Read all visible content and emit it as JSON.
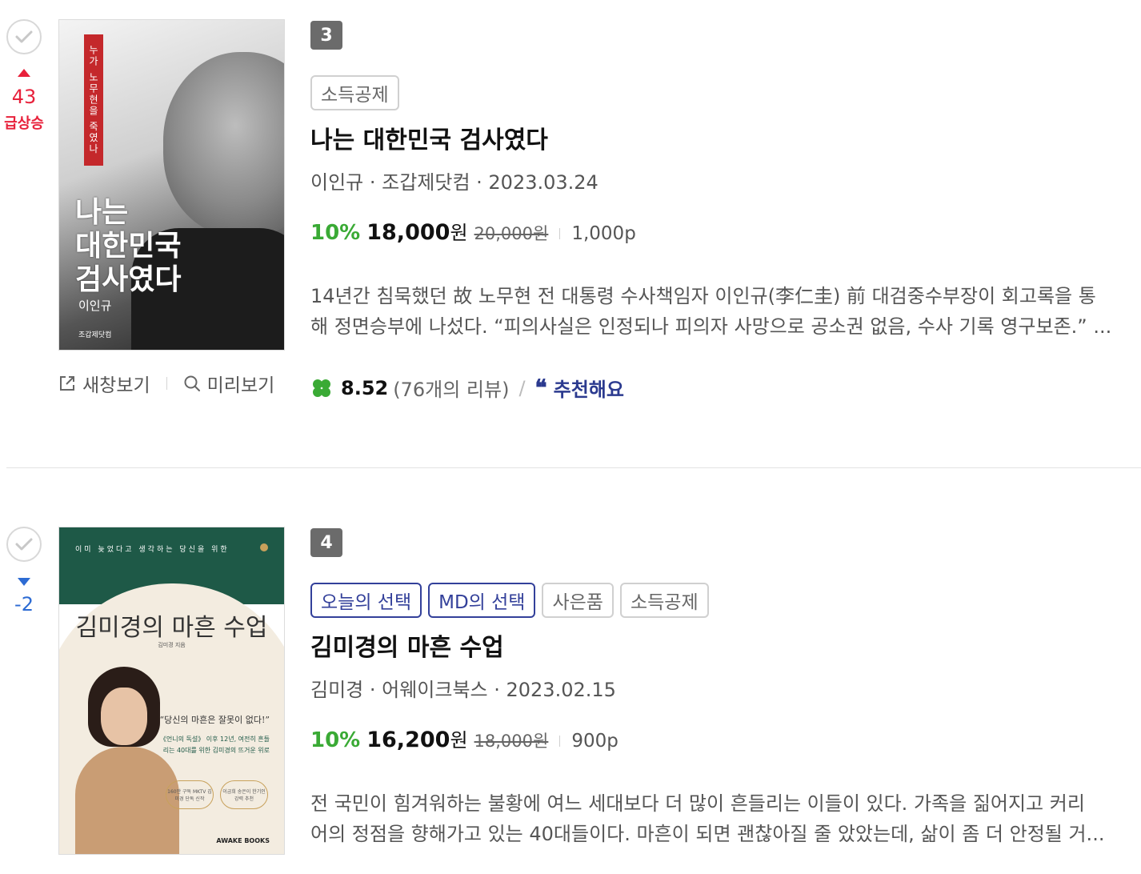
{
  "books": [
    {
      "rank": "3",
      "rank_change": "43",
      "rank_change_label": "급상승",
      "tags": [
        "소득공제"
      ],
      "title": "나는 대한민국 검사였다",
      "meta": "이인규 · 조갑제닷컴 · 2023.03.24",
      "discount": "10%",
      "price": "18,000",
      "won": "원",
      "original_price": "20,000원",
      "points": "1,000p",
      "description_line1": "14년간 침묵했던 故 노무현 전 대통령 수사책임자 이인규(李仁圭) 前 대검중수부장이 회고록을 통",
      "description_line2": "해 정면승부에 나섰다. “피의사실은 인정되나 피의자 사망으로 공소권 없음, 수사 기록 영구보존.” ...",
      "rating": "8.52",
      "review_count": "(76개의 리뷰)",
      "review_sep": "/",
      "recommend": "추천해요",
      "cover": {
        "red_bar": "누가 노무현을 죽였나",
        "title_lines": [
          "나는",
          "대한민국",
          "검사였다"
        ],
        "author": "이인규",
        "publisher": "조갑제닷컴"
      }
    },
    {
      "rank": "4",
      "rank_change": "-2",
      "tags": [
        "오늘의 선택",
        "MD의 선택",
        "사은품",
        "소득공제"
      ],
      "title": "김미경의 마흔 수업",
      "meta": "김미경 · 어웨이크북스 · 2023.02.15",
      "discount": "10%",
      "price": "16,200",
      "won": "원",
      "original_price": "18,000원",
      "points": "900p",
      "description_line1": "전 국민이 힘겨워하는 불황에 여느 세대보다 더 많이 흔들리는 이들이 있다. 가족을 짊어지고 커리",
      "description_line2": "어의 정점을 향해가고 있는 40대들이다. 마흔이 되면 괜찮아질 줄 았았는데, 삶이 좀 더 안정될 거...",
      "cover": {
        "top_line": "이미 늦었다고 생각하는 당신을 위한",
        "title": "김미경의 마흔 수업",
        "subtitle": "김미경 지음",
        "quote": "“당신의 마흔은 잘못이 없다!”",
        "blurb": "《언니의 독설》 이후 12년, 여전히 흔들리는 40대를 위한 김미경의 뜨거운 위로",
        "badge1": "160만 구독 MKTV 김미경 단독 신작",
        "badge2": "이금희 송은이 한기인 강력 추천",
        "logo": "AWAKE BOOKS"
      }
    }
  ],
  "actions": {
    "new_window": "새창보기",
    "preview": "미리보기"
  },
  "colors": {
    "up": "#e8213b",
    "down": "#2d6bd3",
    "discount": "#3aaa35",
    "md_tag": "#33409a"
  }
}
